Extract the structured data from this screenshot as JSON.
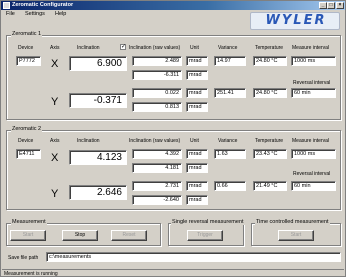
{
  "window": {
    "title": "Zeromatic Configurator",
    "min_symbol": "_",
    "max_symbol": "□",
    "close_symbol": "×"
  },
  "menu": {
    "items": [
      "File",
      "Settings",
      "Help"
    ]
  },
  "logo": {
    "text": "WYLER"
  },
  "headers": {
    "device": "Device",
    "axis": "Axis",
    "inclination": "Inclination",
    "inclination_raw": "Inclination (raw values)",
    "unit": "Unit",
    "variance": "Variance",
    "temperature": "Temperature",
    "measure_interval": "Measure interval",
    "reversal_interval": "Reversal interval"
  },
  "zeromatic1": {
    "title": "Zeromatic 1",
    "raw_checkbox_checked": true,
    "raw_checkbox_mark": "✓",
    "device": "P7772",
    "x": {
      "axis": "X",
      "inclination": "6.900",
      "raw1": "2.489",
      "raw2": "-6.311",
      "unit1": "mrad",
      "unit2": "mrad",
      "variance": "14.97",
      "temperature": "24.80 °C"
    },
    "y": {
      "axis": "Y",
      "inclination": "-0.371",
      "raw1": "0.022",
      "raw2": "0.813",
      "unit1": "mrad",
      "unit2": "mrad",
      "variance": "251.41",
      "temperature": "24.80 °C"
    },
    "measure_interval": "1000 ms",
    "reversal_interval": "60 min"
  },
  "zeromatic2": {
    "title": "Zeromatic 2",
    "device": "E4711",
    "x": {
      "axis": "X",
      "inclination": "4.123",
      "raw1": "4.392",
      "raw2": "4.181",
      "unit1": "mrad",
      "unit2": "mrad",
      "variance": "1.63",
      "temperature": "23.43 °C"
    },
    "y": {
      "axis": "Y",
      "inclination": "2.646",
      "raw1": "2.731",
      "raw2": "-2.640",
      "unit1": "mrad",
      "unit2": "mrad",
      "variance": "0.66",
      "temperature": "21.49 °C"
    },
    "measure_interval": "1000 ms",
    "reversal_interval": "60 min"
  },
  "measurement": {
    "title": "Measurement",
    "start": "Start",
    "stop": "Stop",
    "reset": "Reset"
  },
  "single_reversal": {
    "title": "Single reversal measurement",
    "trigger": "Trigger"
  },
  "time_controlled": {
    "title": "Time controlled measurement",
    "start": "Start"
  },
  "save": {
    "label": "Save file path",
    "path": "c:\\measurements"
  },
  "status": {
    "text": "Measurement is running"
  }
}
